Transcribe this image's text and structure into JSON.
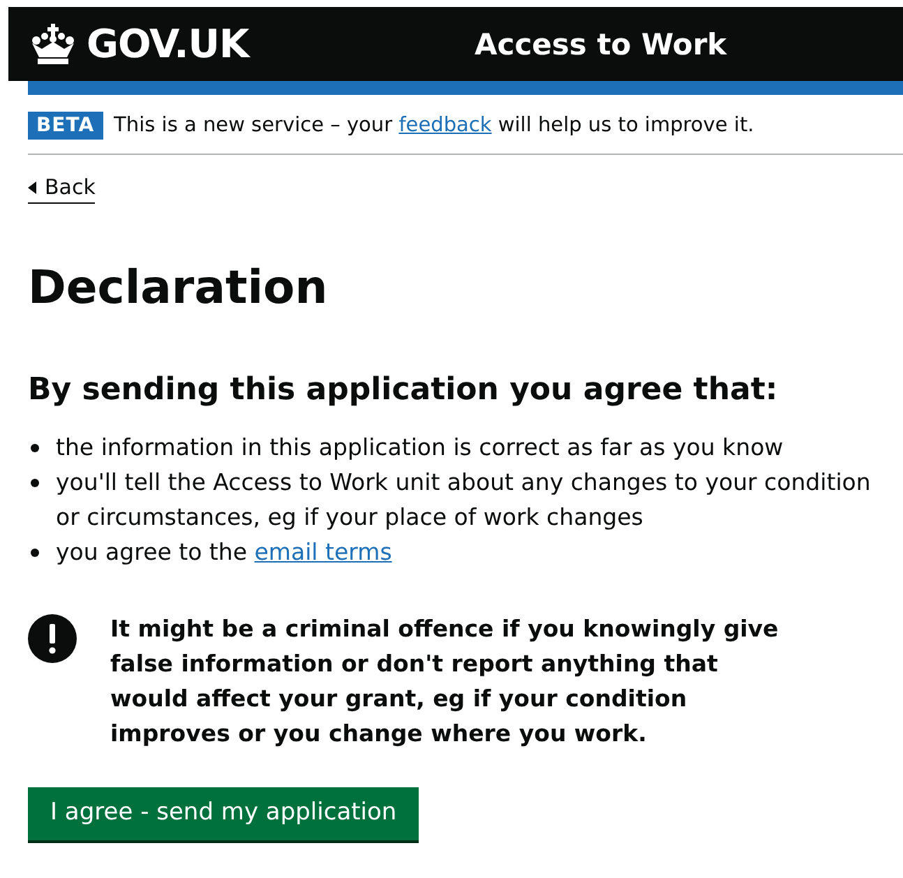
{
  "header": {
    "logo_text": "GOV.UK",
    "service_name": "Access to Work"
  },
  "phase_banner": {
    "tag": "BETA",
    "text_before": "This is a new service – your",
    "link": "feedback",
    "text_after": "will help us to improve it."
  },
  "back_link": "Back",
  "title": "Declaration",
  "subheading": "By sending this application you agree that:",
  "bullets": [
    {
      "text": "the information in this application is correct as far as you know"
    },
    {
      "text": "you'll tell the Access to Work unit about any changes to your condition or circumstances, eg if your place of work changes"
    },
    {
      "text": "you agree to the",
      "link": "email terms"
    }
  ],
  "warning": "It might be a criminal offence if you knowingly give false information or don't report anything that would affect your grant, eg if your condition improves or you change where you work.",
  "button": "I agree - send my application"
}
